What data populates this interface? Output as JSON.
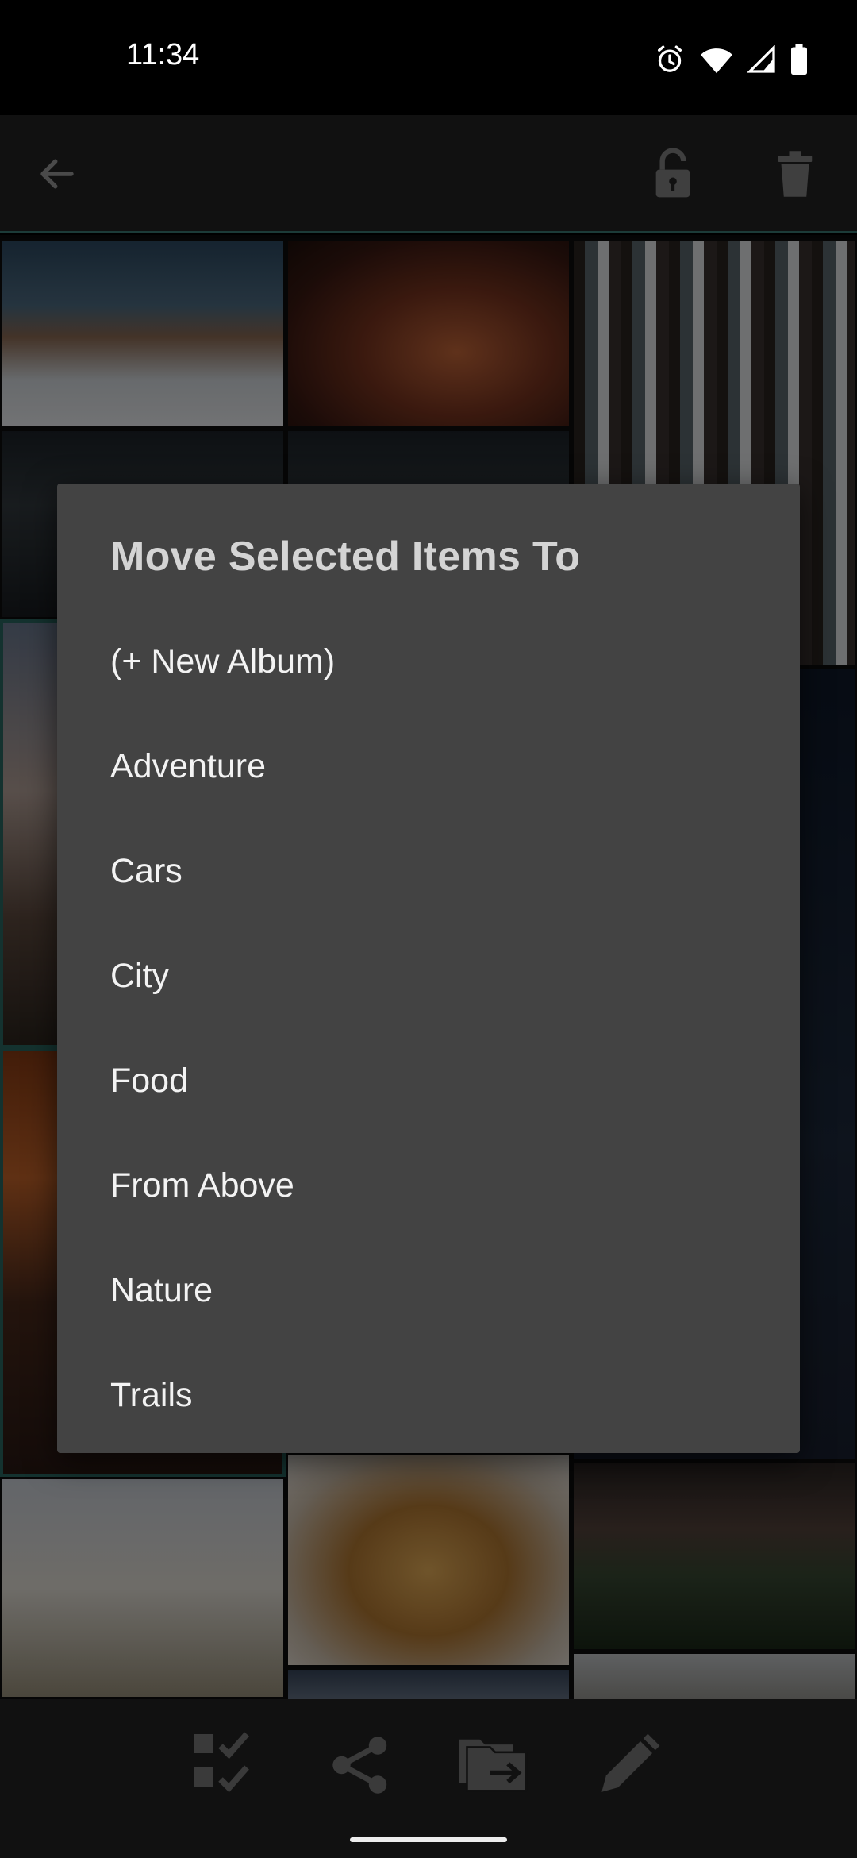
{
  "status_bar": {
    "time": "11:34",
    "icons": [
      "alarm-icon",
      "wifi-icon",
      "signal-icon",
      "battery-icon"
    ]
  },
  "toolbar": {
    "icons": [
      "back-arrow-icon",
      "unlock-icon",
      "trash-icon"
    ]
  },
  "dialog": {
    "title": "Move Selected Items To",
    "albums": [
      "(+ New Album)",
      "Adventure",
      "Cars",
      "City",
      "Food",
      "From Above",
      "Nature",
      "Trails"
    ]
  },
  "bottom_bar": {
    "icons": [
      "select-all-icon",
      "share-icon",
      "move-folder-icon",
      "edit-pencil-icon"
    ]
  },
  "colors": {
    "dialog_bg": "#434343",
    "selection_border": "#2b6a63",
    "toolbar_bg": "#111111"
  }
}
